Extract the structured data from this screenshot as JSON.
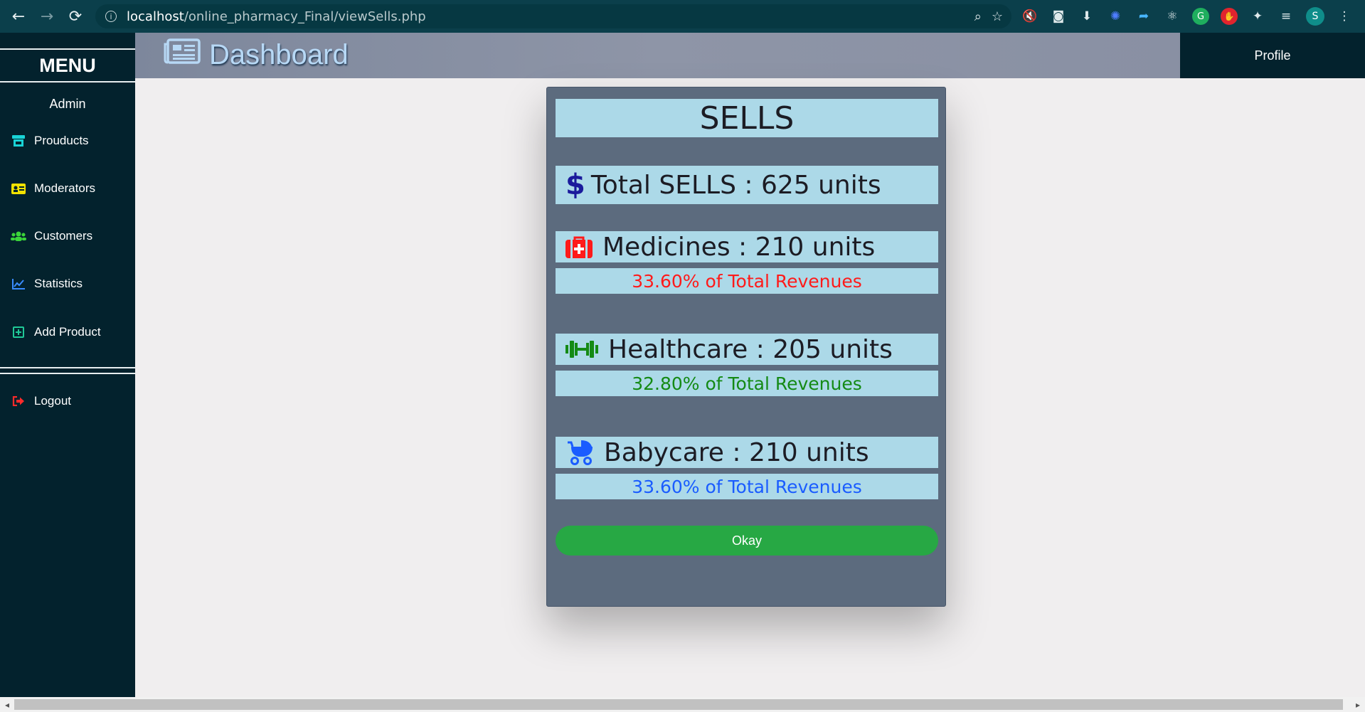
{
  "browser": {
    "url_host": "localhost",
    "url_path": "/online_pharmacy_Final/viewSells.php",
    "profile_initial": "S"
  },
  "sidebar": {
    "menu_title": "MENU",
    "role": "Admin",
    "items": [
      {
        "label": "Prouducts",
        "icon": "store-icon",
        "color": "#19d3d6"
      },
      {
        "label": "Moderators",
        "icon": "id-card-icon",
        "color": "#f2e200"
      },
      {
        "label": "Customers",
        "icon": "users-icon",
        "color": "#3ad43a"
      },
      {
        "label": "Statistics",
        "icon": "chart-line-icon",
        "color": "#3a8cff"
      },
      {
        "label": "Add Product",
        "icon": "plus-square-icon",
        "color": "#20c997"
      }
    ],
    "logout": {
      "label": "Logout",
      "icon": "sign-out-icon",
      "color": "#ff2b2b"
    }
  },
  "header": {
    "title": "Dashboard",
    "profile_label": "Profile"
  },
  "modal": {
    "title": "SELLS",
    "total": {
      "label": "Total SELLS : 625 units",
      "icon": "dollar-icon",
      "color": "#1a1a9c"
    },
    "categories": [
      {
        "label": "Medicines : 210 units",
        "percent_text": "33.60% of Total Revenues",
        "icon": "medkit-icon",
        "color": "#ff1a1a"
      },
      {
        "label": "Healthcare : 205 units",
        "percent_text": "32.80% of Total Revenues",
        "icon": "dumbbell-icon",
        "color": "#148a14"
      },
      {
        "label": "Babycare : 210 units",
        "percent_text": "33.60% of Total Revenues",
        "icon": "baby-carriage-icon",
        "color": "#1a5cff"
      }
    ],
    "okay_label": "Okay"
  }
}
